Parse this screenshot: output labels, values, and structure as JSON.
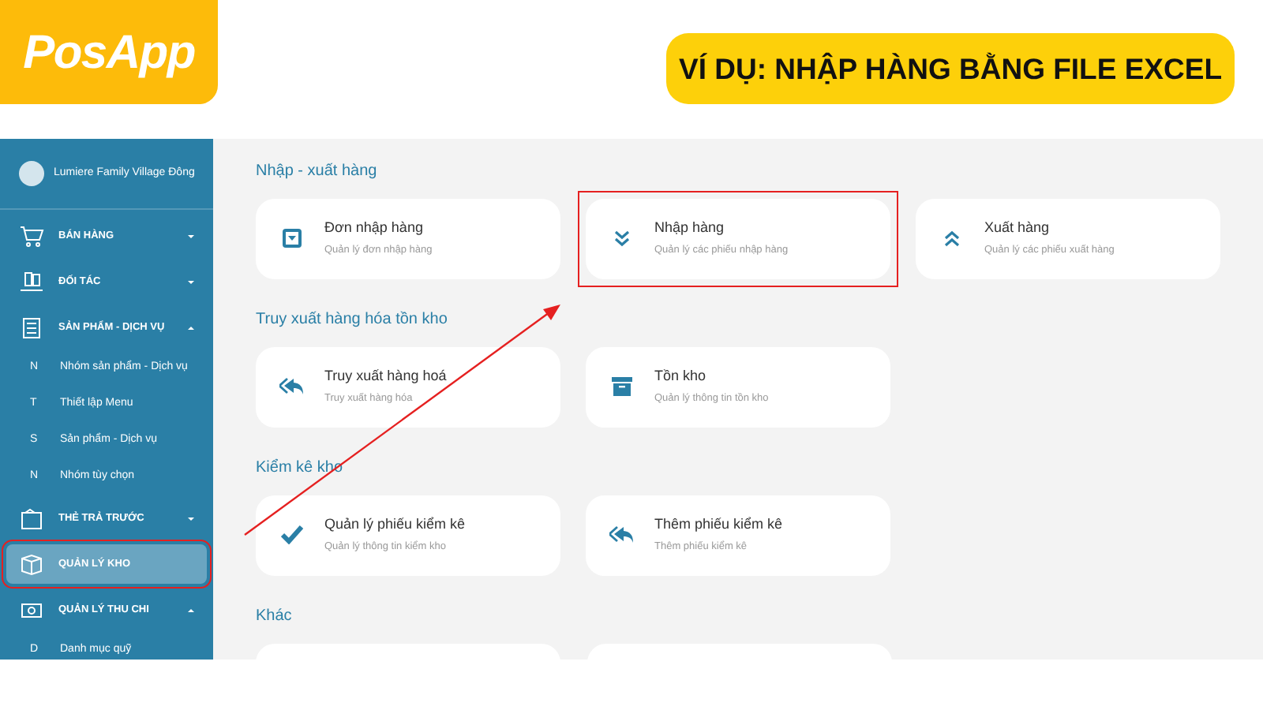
{
  "logo": {
    "text": "PosApp"
  },
  "banner": {
    "title": "VÍ DỤ: NHẬP HÀNG BẰNG FILE EXCEL"
  },
  "sidebar": {
    "user": "Lumiere Family Village Đông",
    "items": [
      {
        "kind": "menu",
        "label": "BÁN HÀNG",
        "expanded": false,
        "selected": false,
        "highlighted": false
      },
      {
        "kind": "menu",
        "label": "ĐỐI TÁC",
        "expanded": false,
        "selected": false,
        "highlighted": false
      },
      {
        "kind": "menu",
        "label": "SẢN PHẨM - DỊCH VỤ",
        "expanded": true,
        "selected": false,
        "highlighted": false
      },
      {
        "kind": "sub",
        "letter": "N",
        "label": "Nhóm sản phẩm - Dịch vụ"
      },
      {
        "kind": "sub",
        "letter": "T",
        "label": "Thiết lập Menu"
      },
      {
        "kind": "sub",
        "letter": "S",
        "label": "Sản phẩm - Dịch vụ"
      },
      {
        "kind": "sub",
        "letter": "N",
        "label": "Nhóm tùy chọn"
      },
      {
        "kind": "menu",
        "label": "THẺ TRẢ TRƯỚC",
        "expanded": false,
        "selected": false,
        "highlighted": false
      },
      {
        "kind": "leaf",
        "label": "QUẢN LÝ KHO",
        "selected": true,
        "highlighted": true
      },
      {
        "kind": "menu",
        "label": "QUẢN LÝ THU CHI",
        "expanded": true,
        "selected": false,
        "highlighted": false
      },
      {
        "kind": "sub",
        "letter": "D",
        "label": "Danh mục quỹ"
      }
    ]
  },
  "sections": [
    {
      "title": "Nhập - xuất hàng",
      "cards": [
        {
          "kind": "full",
          "title": "Đơn nhập hàng",
          "subtitle": "Quản lý đơn nhập hàng",
          "highlighted": false
        },
        {
          "kind": "full",
          "title": "Nhập hàng",
          "subtitle": "Quản lý các phiếu nhập hàng",
          "highlighted": true
        },
        {
          "kind": "full",
          "title": "Xuất hàng",
          "subtitle": "Quản lý các phiếu xuất hàng",
          "highlighted": false
        }
      ]
    },
    {
      "title": "Truy xuất hàng hóa tồn kho",
      "cards": [
        {
          "kind": "full",
          "title": "Truy xuất hàng hoá",
          "subtitle": "Truy xuất hàng hóa",
          "highlighted": false
        },
        {
          "kind": "full",
          "title": "Tồn kho",
          "subtitle": "Quản lý thông tin tồn kho",
          "highlighted": false
        }
      ]
    },
    {
      "title": "Kiểm kê kho",
      "cards": [
        {
          "kind": "full",
          "title": "Quản lý phiếu kiểm kê",
          "subtitle": "Quản lý thông tin kiểm kho",
          "highlighted": false
        },
        {
          "kind": "full",
          "title": "Thêm phiếu kiểm kê",
          "subtitle": "Thêm phiếu kiểm kê",
          "highlighted": false
        }
      ]
    },
    {
      "title": "Khác",
      "cards": [
        {
          "kind": "cut"
        },
        {
          "kind": "cut"
        }
      ]
    }
  ]
}
